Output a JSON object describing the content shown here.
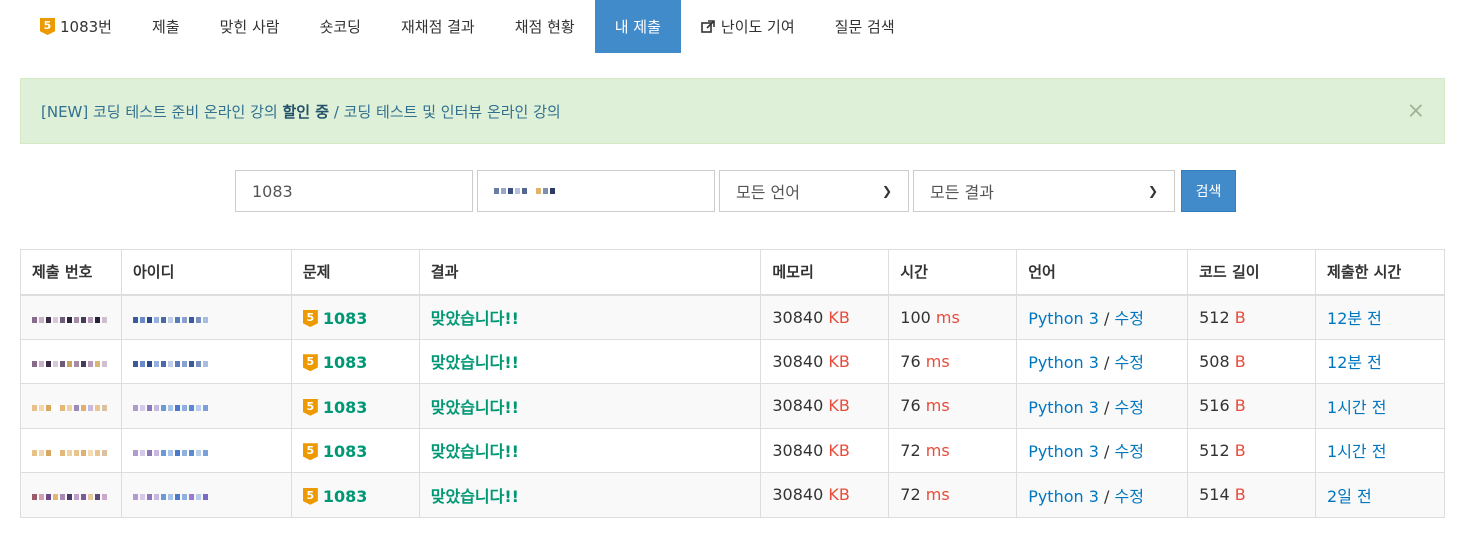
{
  "nav": {
    "problem_badge": "5",
    "problem_label": "1083번",
    "submit": "제출",
    "solved_users": "맞힌 사람",
    "shortcoding": "숏코딩",
    "rejudge_result": "재채점 결과",
    "judge_status": "채점 현황",
    "my_submissions": "내 제출",
    "difficulty_contrib": "난이도 기여",
    "question_search": "질문 검색"
  },
  "alert": {
    "prefix": "[NEW] 코딩 테스트 준비 온라인 강의 ",
    "bold": "할인 중",
    "suffix": " / 코딩 테스트 및 인터뷰 온라인 강의",
    "close": "×"
  },
  "search": {
    "problem_id": "1083",
    "language": "모든 언어",
    "result": "모든 결과",
    "button": "검색"
  },
  "table": {
    "headers": [
      "제출 번호",
      "아이디",
      "문제",
      "결과",
      "메모리",
      "시간",
      "언어",
      "코드 길이",
      "제출한 시간"
    ],
    "rows": [
      {
        "problem": "1083",
        "tier": "5",
        "result": "맞았습니다!!",
        "memory": "30840",
        "memory_unit": "KB",
        "time": "100",
        "time_unit": "ms",
        "language": "Python 3",
        "edit": "수정",
        "code_length": "512",
        "code_unit": "B",
        "submitted": "12분 전"
      },
      {
        "problem": "1083",
        "tier": "5",
        "result": "맞았습니다!!",
        "memory": "30840",
        "memory_unit": "KB",
        "time": "76",
        "time_unit": "ms",
        "language": "Python 3",
        "edit": "수정",
        "code_length": "508",
        "code_unit": "B",
        "submitted": "12분 전"
      },
      {
        "problem": "1083",
        "tier": "5",
        "result": "맞았습니다!!",
        "memory": "30840",
        "memory_unit": "KB",
        "time": "76",
        "time_unit": "ms",
        "language": "Python 3",
        "edit": "수정",
        "code_length": "516",
        "code_unit": "B",
        "submitted": "1시간 전"
      },
      {
        "problem": "1083",
        "tier": "5",
        "result": "맞았습니다!!",
        "memory": "30840",
        "memory_unit": "KB",
        "time": "72",
        "time_unit": "ms",
        "language": "Python 3",
        "edit": "수정",
        "code_length": "512",
        "code_unit": "B",
        "submitted": "1시간 전"
      },
      {
        "problem": "1083",
        "tier": "5",
        "result": "맞았습니다!!",
        "memory": "30840",
        "memory_unit": "KB",
        "time": "72",
        "time_unit": "ms",
        "language": "Python 3",
        "edit": "수정",
        "code_length": "514",
        "code_unit": "B",
        "submitted": "2일 전"
      }
    ]
  },
  "colors": {
    "accent": "#428bca",
    "success_text": "#009874",
    "unit_red": "#e74c3c",
    "link_blue": "#0076c0",
    "alert_bg": "#dff0d8",
    "tier_gold": "#ec9a00"
  }
}
